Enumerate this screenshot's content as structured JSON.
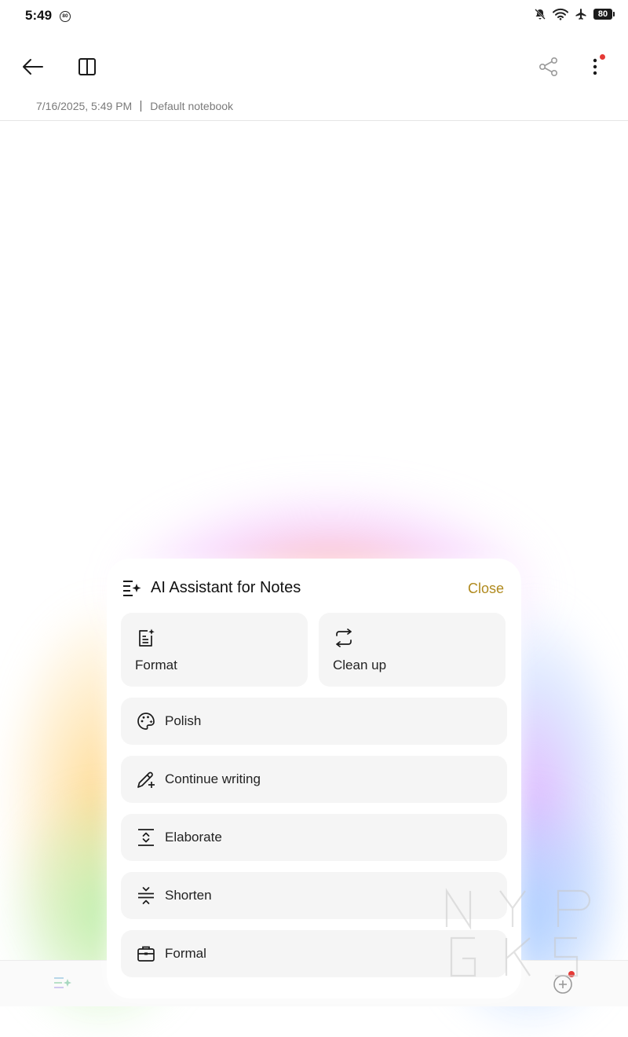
{
  "status_bar": {
    "time": "5:49",
    "badge": "80",
    "battery": "80"
  },
  "note": {
    "datetime": "7/16/2025, 5:49 PM",
    "notebook": "Default notebook"
  },
  "ai_panel": {
    "title": "AI Assistant for Notes",
    "close_label": "Close",
    "actions": [
      {
        "label": "Format",
        "icon": "format-icon"
      },
      {
        "label": "Clean up",
        "icon": "clean-up-icon"
      },
      {
        "label": "Polish",
        "icon": "palette-icon"
      },
      {
        "label": "Continue writing",
        "icon": "pencil-plus-icon"
      },
      {
        "label": "Elaborate",
        "icon": "expand-icon"
      },
      {
        "label": "Shorten",
        "icon": "compress-icon"
      },
      {
        "label": "Formal",
        "icon": "briefcase-icon"
      }
    ]
  },
  "colors": {
    "accent": "#b08a1e",
    "tile_bg": "#f5f5f5",
    "notification_dot": "#e53935"
  }
}
